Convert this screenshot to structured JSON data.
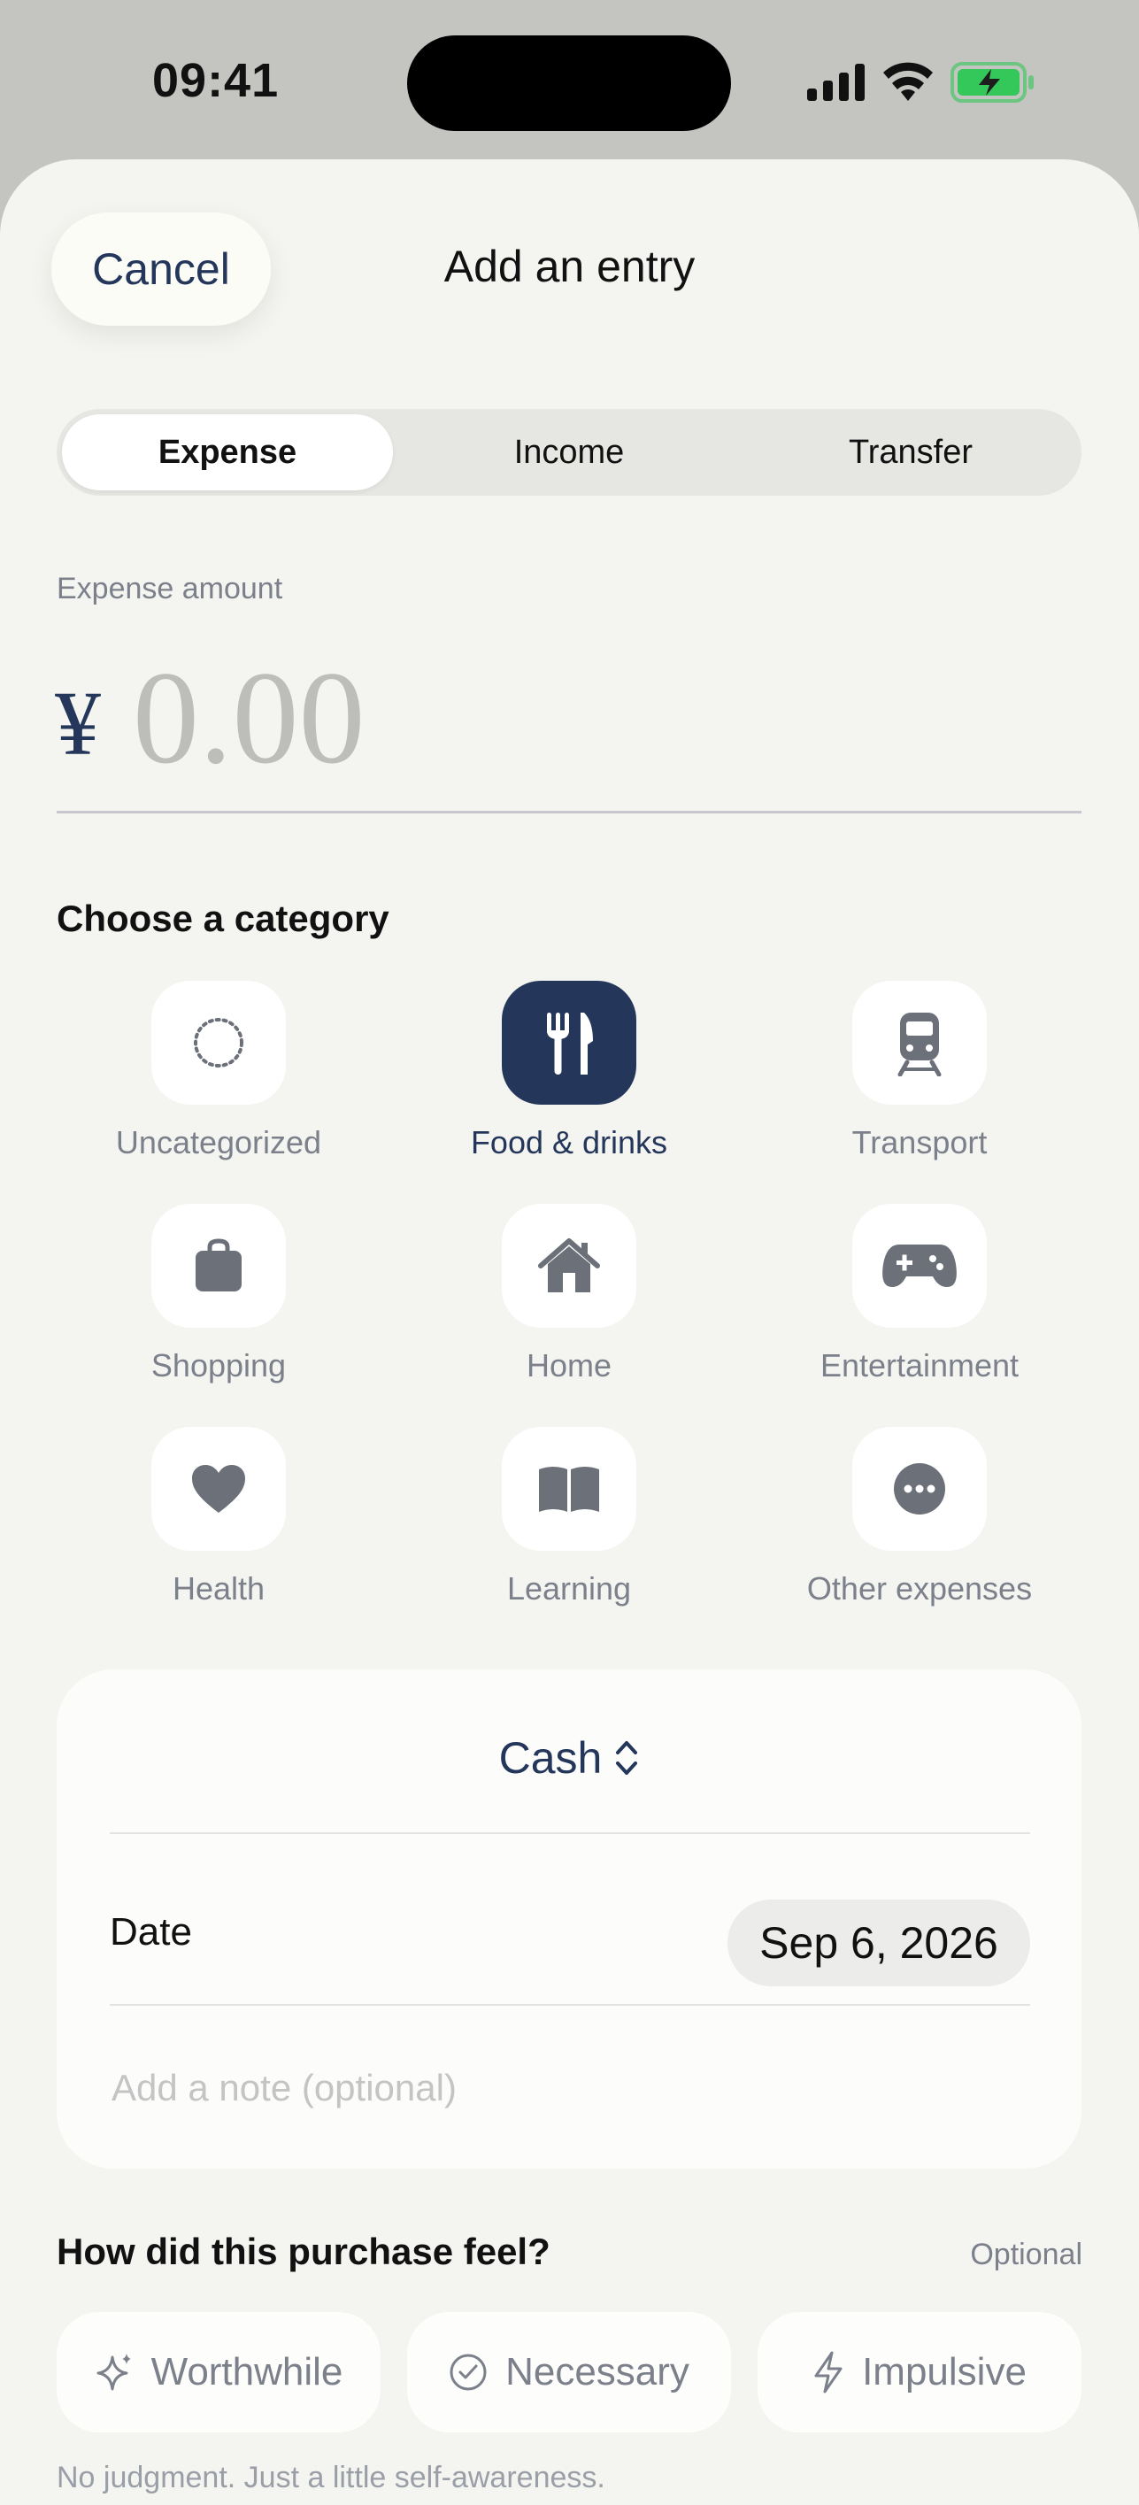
{
  "status_bar": {
    "time": "09:41"
  },
  "sheet": {
    "cancel_label": "Cancel",
    "title": "Add an entry"
  },
  "type_tabs": [
    {
      "label": "Expense",
      "active": true
    },
    {
      "label": "Income",
      "active": false
    },
    {
      "label": "Transfer",
      "active": false
    }
  ],
  "amount": {
    "label": "Expense amount",
    "currency_symbol": "¥",
    "value": "0.00"
  },
  "category_section": {
    "title": "Choose a category",
    "items": [
      {
        "label": "Uncategorized",
        "icon": "dotted-circle-icon",
        "selected": false
      },
      {
        "label": "Food & drinks",
        "icon": "fork-knife-icon",
        "selected": true
      },
      {
        "label": "Transport",
        "icon": "tram-icon",
        "selected": false
      },
      {
        "label": "Shopping",
        "icon": "shopping-bag-icon",
        "selected": false
      },
      {
        "label": "Home",
        "icon": "house-icon",
        "selected": false
      },
      {
        "label": "Entertainment",
        "icon": "gamepad-icon",
        "selected": false
      },
      {
        "label": "Health",
        "icon": "heart-icon",
        "selected": false
      },
      {
        "label": "Learning",
        "icon": "book-icon",
        "selected": false
      },
      {
        "label": "Other expenses",
        "icon": "ellipsis-circle-icon",
        "selected": false
      }
    ]
  },
  "details": {
    "account": "Cash",
    "date_label": "Date",
    "date_value": "Sep 6, 2026",
    "note_placeholder": "Add a note (optional)"
  },
  "feeling": {
    "title": "How did this purchase feel?",
    "optional_label": "Optional",
    "options": [
      {
        "label": "Worthwhile",
        "icon": "sparkle-icon"
      },
      {
        "label": "Necessary",
        "icon": "check-circle-icon"
      },
      {
        "label": "Impulsive",
        "icon": "lightning-icon"
      }
    ],
    "footnote": "No judgment. Just a little self-awareness."
  },
  "colors": {
    "accent": "#24375a",
    "sheet_bg": "#f4f4f1",
    "muted_text": "#7b808a",
    "battery_green": "#34c759"
  }
}
